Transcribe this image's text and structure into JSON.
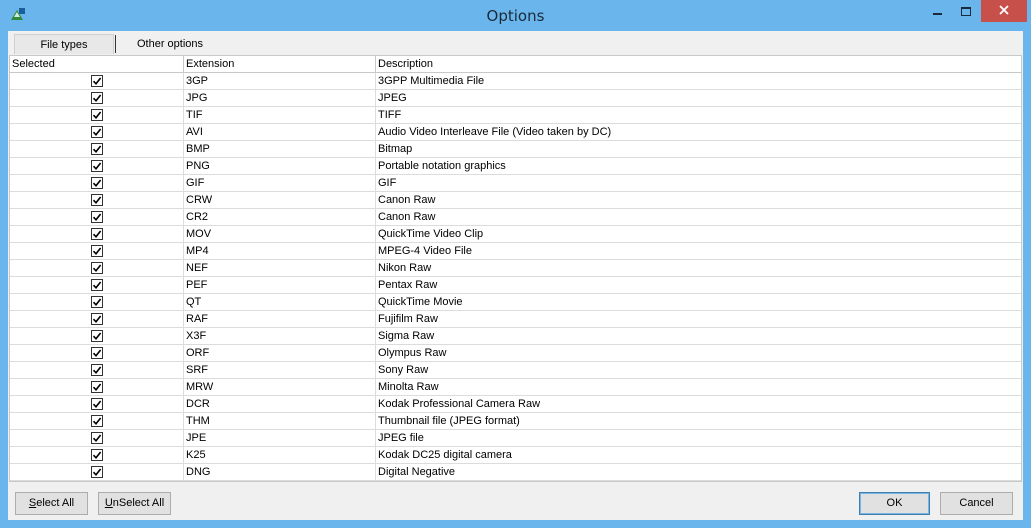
{
  "window": {
    "title": "Options",
    "colors": {
      "titlebar": "#6ab6ec",
      "close_button": "#c7504a",
      "client": "#f0f0f0"
    }
  },
  "tabs": [
    {
      "label": "File types",
      "active": true
    },
    {
      "label": "Other options",
      "active": false
    }
  ],
  "table": {
    "columns": [
      "Selected",
      "Extension",
      "Description"
    ],
    "rows": [
      {
        "selected": true,
        "extension": "3GP",
        "description": "3GPP Multimedia File"
      },
      {
        "selected": true,
        "extension": "JPG",
        "description": "JPEG"
      },
      {
        "selected": true,
        "extension": "TIF",
        "description": "TIFF"
      },
      {
        "selected": true,
        "extension": "AVI",
        "description": "Audio Video Interleave File (Video taken by DC)"
      },
      {
        "selected": true,
        "extension": "BMP",
        "description": "Bitmap"
      },
      {
        "selected": true,
        "extension": "PNG",
        "description": "Portable notation graphics"
      },
      {
        "selected": true,
        "extension": "GIF",
        "description": "GIF"
      },
      {
        "selected": true,
        "extension": "CRW",
        "description": "Canon Raw"
      },
      {
        "selected": true,
        "extension": "CR2",
        "description": "Canon Raw"
      },
      {
        "selected": true,
        "extension": "MOV",
        "description": "QuickTime Video Clip"
      },
      {
        "selected": true,
        "extension": "MP4",
        "description": "MPEG-4 Video File"
      },
      {
        "selected": true,
        "extension": "NEF",
        "description": "Nikon Raw"
      },
      {
        "selected": true,
        "extension": "PEF",
        "description": "Pentax Raw"
      },
      {
        "selected": true,
        "extension": "QT",
        "description": "QuickTime Movie"
      },
      {
        "selected": true,
        "extension": "RAF",
        "description": "Fujifilm Raw"
      },
      {
        "selected": true,
        "extension": "X3F",
        "description": "Sigma Raw"
      },
      {
        "selected": true,
        "extension": "ORF",
        "description": "Olympus Raw"
      },
      {
        "selected": true,
        "extension": "SRF",
        "description": "Sony Raw"
      },
      {
        "selected": true,
        "extension": "MRW",
        "description": "Minolta Raw"
      },
      {
        "selected": true,
        "extension": "DCR",
        "description": "Kodak Professional Camera Raw"
      },
      {
        "selected": true,
        "extension": "THM",
        "description": "Thumbnail file (JPEG format)"
      },
      {
        "selected": true,
        "extension": "JPE",
        "description": "JPEG file"
      },
      {
        "selected": true,
        "extension": "K25",
        "description": "Kodak DC25 digital camera"
      },
      {
        "selected": true,
        "extension": "DNG",
        "description": "Digital Negative"
      }
    ]
  },
  "buttons": {
    "select_all": {
      "mnemonic": "S",
      "rest": "elect All"
    },
    "unselect_all": {
      "mnemonic": "U",
      "rest": "nSelect All"
    },
    "ok": "OK",
    "cancel": "Cancel"
  },
  "icons": {
    "app": "recycle-photo-icon",
    "minimize": "minimize-icon",
    "maximize": "maximize-icon",
    "close": "close-icon",
    "check": "check-icon"
  }
}
